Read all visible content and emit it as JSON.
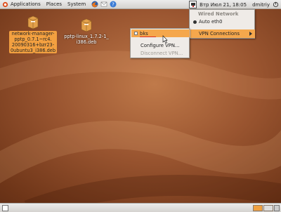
{
  "top_panel": {
    "menus": [
      "Applications",
      "Places",
      "System"
    ],
    "clock": "Втр Июл 21, 18:05",
    "user": "dmitriy",
    "launchers": [
      "firefox-icon",
      "email-icon",
      "help-icon"
    ]
  },
  "desktop": {
    "icons": [
      {
        "label": "network-manager-pptp_0.7.1~rc4.20090316+bzr23-0ubuntu3_i386.deb",
        "lines": [
          "network-manager-",
          "pptp_0.7.1~rc4.",
          "20090316+bzr23-",
          "0ubuntu3_i386.deb"
        ]
      },
      {
        "label": "pptp-linux_1.7.2-1_i386.deb",
        "lines": [
          "pptp-linux_1.7.2-1_",
          "i386.deb"
        ]
      }
    ]
  },
  "nm_menu": {
    "header": "Wired Network",
    "connection": "Auto eth0",
    "vpn_label": "VPN Connections"
  },
  "vpn_menu": {
    "bks": "bks",
    "configure": "Configure VPN...",
    "disconnect": "Disconnect VPN..."
  },
  "colors": {
    "accent": "#f5a74c",
    "panel": "#e0deda"
  }
}
